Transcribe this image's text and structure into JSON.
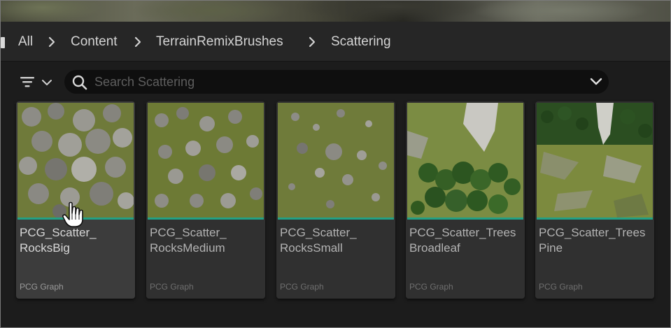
{
  "breadcrumb": {
    "items": [
      "All",
      "Content",
      "TerrainRemixBrushes",
      "Scattering"
    ]
  },
  "search": {
    "placeholder": "Search Scattering",
    "value": ""
  },
  "assets": [
    {
      "name": "PCG_Scatter_\nRocksBig",
      "type": "PCG Graph",
      "selected": true
    },
    {
      "name": "PCG_Scatter_\nRocksMedium",
      "type": "PCG Graph",
      "selected": false
    },
    {
      "name": "PCG_Scatter_\nRocksSmall",
      "type": "PCG Graph",
      "selected": false
    },
    {
      "name": "PCG_Scatter_Trees\nBroadleaf",
      "type": "PCG Graph",
      "selected": false
    },
    {
      "name": "PCG_Scatter_Trees\nPine",
      "type": "PCG Graph",
      "selected": false
    }
  ],
  "colors": {
    "accent": "#22a085",
    "panel": "#1c1c1c",
    "tile": "#303030"
  },
  "icons": [
    "chevron-right-icon",
    "filter-icon",
    "chevron-down-icon",
    "search-icon",
    "hand-cursor-icon"
  ]
}
